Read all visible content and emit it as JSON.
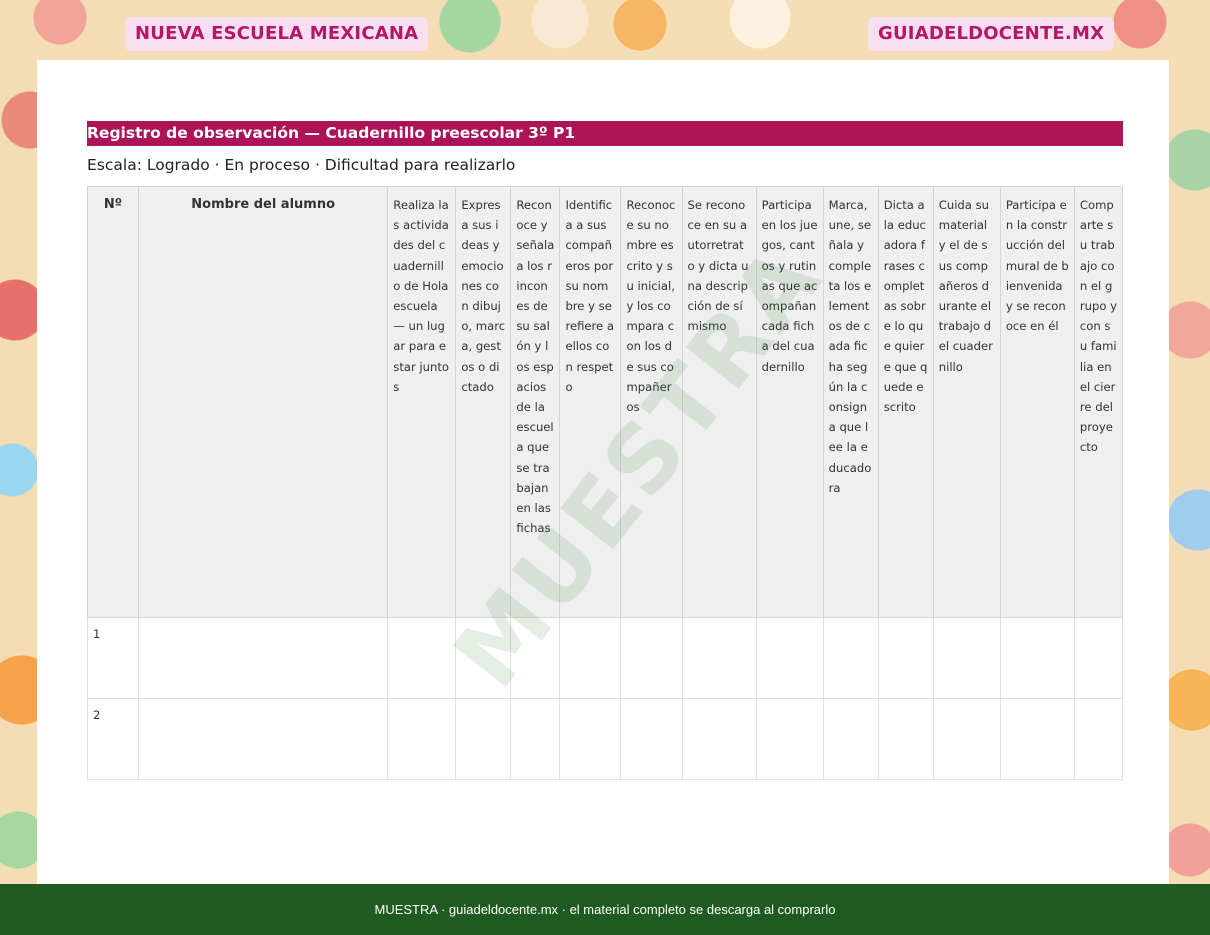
{
  "header": {
    "badge_left": "NUEVA ESCUELA MEXICANA",
    "badge_right": "GUIADELDOCENTE.MX"
  },
  "document": {
    "title": "Registro de observación — Cuadernillo preescolar 3º P1",
    "scale": "Escala: Logrado · En proceso · Dificultad para realizarlo"
  },
  "table": {
    "columns": [
      "Nº",
      "Nombre del alumno",
      "Realiza las actividades del cuadernillo de Hola escuela — un lugar para estar juntos",
      "Expresa sus ideas y emociones con dibujo, marca, gestos o dictado",
      "Reconoce y señala a los rincones de su salón y los espacios de la escuela que se trabajan en las fichas",
      "Identifica a sus compañeros por su nombre y se refiere a ellos con respeto",
      "Reconoce su nombre escrito y su inicial, y los compara con los de sus compañeros",
      "Se reconoce en su autorretrato y dicta una descripción de sí mismo",
      "Participa en los juegos, cantos y rutinas que acompañan cada ficha del cuadernillo",
      "Marca, une, señala y completa los elementos de cada ficha según la consigna que lee la educadora",
      "Dicta a la educadora frases completas sobre lo que quiere que quede escrito",
      "Cuida su material y el de sus compañeros durante el trabajo del cuadernillo",
      "Participa en la construcción del mural de bienvenida y se reconoce en él",
      "Comparte su trabajo con el grupo y con su familia en el cierre del proyecto"
    ],
    "rows": [
      {
        "num": "1"
      },
      {
        "num": "2"
      }
    ]
  },
  "watermark": "MUESTRA",
  "footer": {
    "text": "MUESTRA · guiadeldocente.mx · el material completo se descarga al comprarlo"
  }
}
